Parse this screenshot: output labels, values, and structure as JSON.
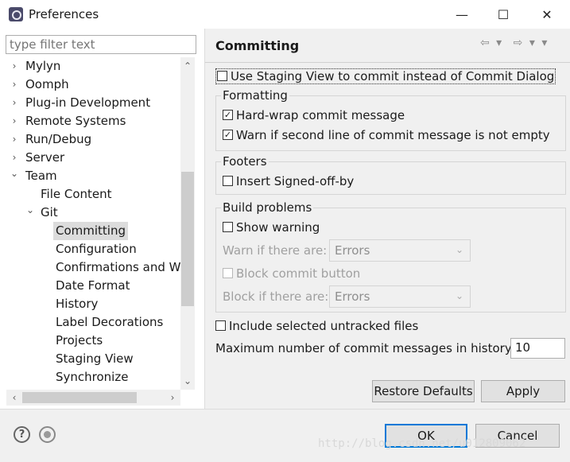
{
  "window": {
    "title": "Preferences",
    "minimize": "—",
    "maximize": "☐",
    "close": "✕"
  },
  "left": {
    "filter_placeholder": "type filter text",
    "tree": [
      {
        "label": "Mylyn",
        "twisty": "›"
      },
      {
        "label": "Oomph",
        "twisty": "›"
      },
      {
        "label": "Plug-in Development",
        "twisty": "›"
      },
      {
        "label": "Remote Systems",
        "twisty": "›"
      },
      {
        "label": "Run/Debug",
        "twisty": "›"
      },
      {
        "label": "Server",
        "twisty": "›"
      },
      {
        "label": "Team",
        "twisty": "⌄"
      },
      {
        "label": "File Content",
        "twisty": ""
      },
      {
        "label": "Git",
        "twisty": "⌄"
      },
      {
        "label": "Committing",
        "twisty": ""
      },
      {
        "label": "Configuration",
        "twisty": ""
      },
      {
        "label": "Confirmations and Wa",
        "twisty": ""
      },
      {
        "label": "Date Format",
        "twisty": ""
      },
      {
        "label": "History",
        "twisty": ""
      },
      {
        "label": "Label Decorations",
        "twisty": ""
      },
      {
        "label": "Projects",
        "twisty": ""
      },
      {
        "label": "Staging View",
        "twisty": ""
      },
      {
        "label": "Synchronize",
        "twisty": ""
      }
    ],
    "selected_item": "Committing"
  },
  "right": {
    "page_title": "Committing",
    "nav_back": "⇦ ▾",
    "nav_forward": "⇨ ▾ ▾",
    "use_staging_view": {
      "label": "Use Staging View to commit instead of Commit Dialog",
      "checked": false
    },
    "formatting": {
      "label": "Formatting",
      "hard_wrap": {
        "label": "Hard-wrap commit message",
        "checked": true
      },
      "warn_second_line": {
        "label": "Warn if second line of commit message is not empty",
        "checked": true
      }
    },
    "footers": {
      "label": "Footers",
      "signed_off": {
        "label": "Insert Signed-off-by",
        "checked": false
      }
    },
    "build_problems": {
      "label": "Build problems",
      "show_warning": {
        "label": "Show warning",
        "checked": false
      },
      "warn_if_label": "Warn if there are:",
      "warn_if_value": "Errors",
      "block_commit": {
        "label": "Block commit button",
        "checked": false
      },
      "block_if_label": "Block if there are:",
      "block_if_value": "Errors"
    },
    "include_untracked": {
      "label": "Include selected untracked files",
      "checked": false
    },
    "max_history_label": "Maximum number of commit messages in history:",
    "max_history_value": "10",
    "restore_defaults": "Restore Defaults",
    "apply": "Apply"
  },
  "footer": {
    "ok": "OK",
    "cancel": "Cancel",
    "watermark": "http://blog.csdn.net/u012809062"
  },
  "colors": {
    "accent": "#0078d7",
    "panel_bg": "#f0f0f0",
    "selection_bg": "#dcdcdc"
  }
}
